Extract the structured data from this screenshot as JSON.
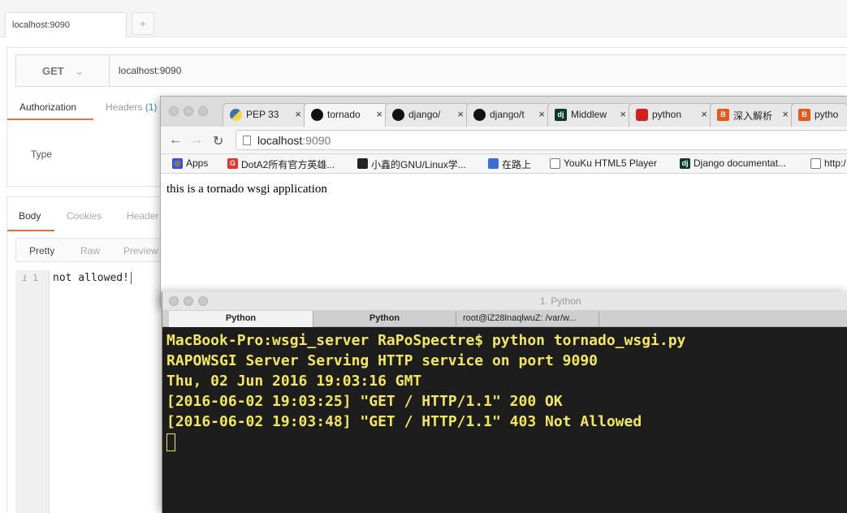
{
  "postman": {
    "tab_label": "localhost:9090",
    "new_tab": "+",
    "method": "GET",
    "method_chevron": "⌄",
    "url": "localhost:9090",
    "request_tabs": [
      {
        "label": "Authorization"
      },
      {
        "label": "Headers",
        "badge": "(1)"
      }
    ],
    "type_label": "Type",
    "response_tabs": [
      "Body",
      "Cookies",
      "Header"
    ],
    "view_modes": [
      "Pretty",
      "Raw",
      "Preview"
    ],
    "gutter_marker": "i",
    "line_number": "1",
    "response_body": "not allowed!",
    "accent_color": "#f26b3a"
  },
  "chrome": {
    "tabs": [
      {
        "label": "PEP 33",
        "icon": "python-icon",
        "close": "×"
      },
      {
        "label": "tornado",
        "icon": "github-icon",
        "close": "×"
      },
      {
        "label": "django/",
        "icon": "github-icon",
        "close": "×"
      },
      {
        "label": "django/t",
        "icon": "github-icon",
        "close": "×"
      },
      {
        "label": "Middlew",
        "icon": "django-icon",
        "close": "×"
      },
      {
        "label": "python",
        "icon": "shield-icon",
        "close": "×"
      },
      {
        "label": "深入解析",
        "icon": "blog-icon",
        "close": "×"
      },
      {
        "label": "pytho",
        "icon": "blog-icon",
        "close": ""
      }
    ],
    "back": "←",
    "forward": "→",
    "reload": "↻",
    "address_host": "localhost",
    "address_port": ":9090",
    "bookmarks": [
      {
        "label": "Apps",
        "icon": "apps-icon"
      },
      {
        "label": "DotA2所有官方英雄...",
        "icon": "g-icon"
      },
      {
        "label": "小鑫的GNU/Linux学...",
        "icon": "tux-icon"
      },
      {
        "label": "在路上",
        "icon": "road-icon"
      },
      {
        "label": "YouKu HTML5 Player",
        "icon": "doc-icon"
      },
      {
        "label": "Django documentat...",
        "icon": "django-icon"
      },
      {
        "label": "http:/",
        "icon": "doc-icon"
      }
    ],
    "page_text": "this is a tornado wsgi application"
  },
  "terminal": {
    "title": "1. Python",
    "tabs": [
      "Python",
      "Python",
      "root@iZ28lnaqlwuZ: /var/w..."
    ],
    "lines": [
      "MacBook-Pro:wsgi_server RaPoSpectre$ python tornado_wsgi.py",
      "RAPOWSGI Server Serving HTTP service on port 9090",
      "Thu, 02 Jun 2016 19:03:16 GMT",
      "[2016-06-02 19:03:25] \"GET / HTTP/1.1\" 200 OK",
      "[2016-06-02 19:03:48] \"GET / HTTP/1.1\" 403 Not Allowed"
    ],
    "text_color": "#f3e75c"
  }
}
